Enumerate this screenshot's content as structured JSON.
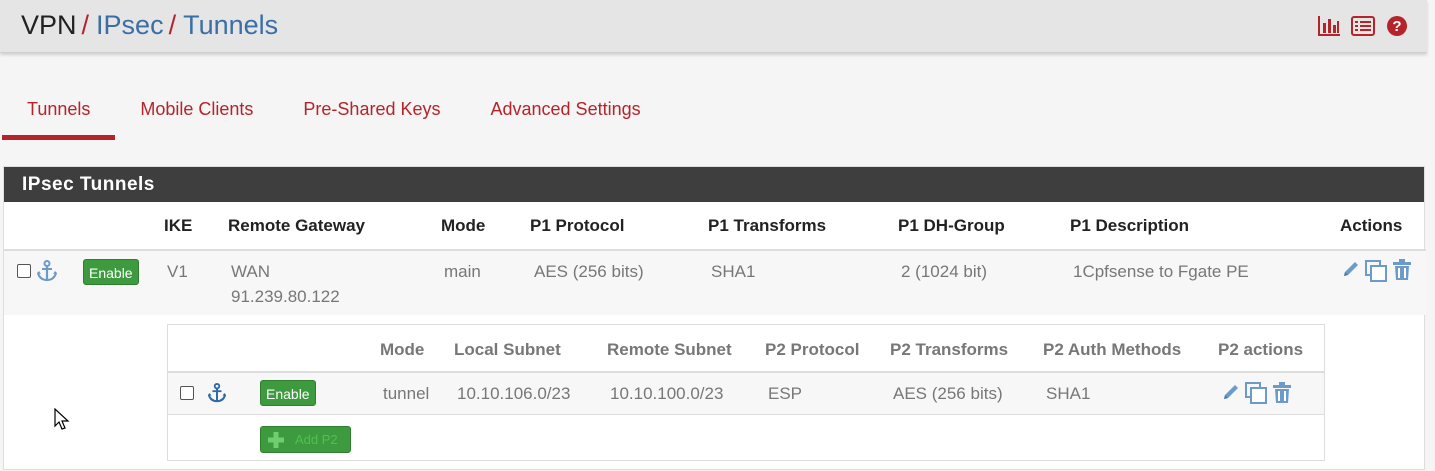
{
  "breadcrumb": {
    "root": "VPN",
    "sep": "/",
    "items": [
      "IPsec",
      "Tunnels"
    ]
  },
  "header_icons": [
    "chart-icon",
    "list-icon",
    "help-icon"
  ],
  "tabs": [
    {
      "label": "Tunnels",
      "active": true
    },
    {
      "label": "Mobile Clients",
      "active": false
    },
    {
      "label": "Pre-Shared Keys",
      "active": false
    },
    {
      "label": "Advanced Settings",
      "active": false
    }
  ],
  "panel": {
    "title": "IPsec Tunnels"
  },
  "p1_table": {
    "headers": {
      "ike": "IKE",
      "remote_gateway": "Remote Gateway",
      "mode": "Mode",
      "p1_protocol": "P1 Protocol",
      "p1_transforms": "P1 Transforms",
      "p1_dh_group": "P1 DH-Group",
      "p1_description": "P1 Description",
      "actions": "Actions"
    },
    "row": {
      "enable_label": "Enable",
      "ike": "V1",
      "gateway_iface": "WAN",
      "gateway_ip": "91.239.80.122",
      "mode": "main",
      "protocol": "AES (256 bits)",
      "transforms": "SHA1",
      "dh_group": "2 (1024 bit)",
      "description": "1Cpfsense to Fgate PE"
    }
  },
  "p2_table": {
    "headers": {
      "mode": "Mode",
      "local_subnet": "Local Subnet",
      "remote_subnet": "Remote Subnet",
      "p2_protocol": "P2 Protocol",
      "p2_transforms": "P2 Transforms",
      "p2_auth_methods": "P2 Auth Methods",
      "p2_actions": "P2 actions"
    },
    "row": {
      "enable_label": "Enable",
      "mode": "tunnel",
      "local_subnet": "10.10.106.0/23",
      "remote_subnet": "10.10.100.0/23",
      "protocol": "ESP",
      "transforms": "AES (256 bits)",
      "auth_methods": "SHA1"
    },
    "add_label": "Add P2"
  },
  "colors": {
    "accent": "#b5242b",
    "link": "#3a6ea5",
    "success": "#3e9a3e",
    "panel_header": "#3e3e3e",
    "icon_blue": "#6c9ac9"
  }
}
